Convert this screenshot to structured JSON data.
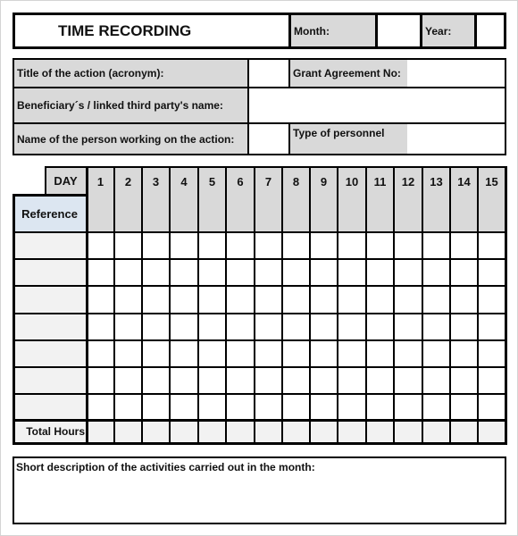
{
  "header": {
    "title": "TIME RECORDING",
    "month_label": "Month:",
    "month_value": "",
    "year_label": "Year:",
    "year_value": ""
  },
  "info": {
    "title_label": "Title of the action (acronym):",
    "title_value": "",
    "grant_label": "Grant Agreement No:",
    "grant_value": "",
    "beneficiary_label": "Beneficiary´s / linked third party's name:",
    "beneficiary_value": "",
    "person_label": "Name of the person working on the action:",
    "person_value": "",
    "personnel_label": "Type of personnel",
    "personnel_value": ""
  },
  "grid": {
    "day_label": "DAY",
    "reference_label": "Reference",
    "days": [
      "1",
      "2",
      "3",
      "4",
      "5",
      "6",
      "7",
      "8",
      "9",
      "10",
      "11",
      "12",
      "13",
      "14",
      "15"
    ],
    "row_count": 7,
    "total_label": "Total Hours"
  },
  "description": {
    "label": "Short description of the activities carried out in the month:",
    "value": ""
  }
}
